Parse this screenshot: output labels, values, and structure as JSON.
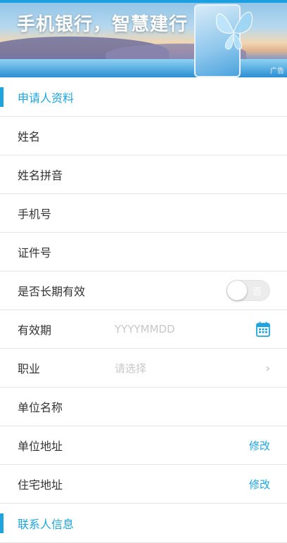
{
  "banner": {
    "slogan": "手机银行，智慧建行",
    "ad_label": "广告"
  },
  "applicant_section": {
    "title": "申请人资料"
  },
  "fields": {
    "name": {
      "label": "姓名"
    },
    "name_pinyin": {
      "label": "姓名拼音"
    },
    "phone": {
      "label": "手机号"
    },
    "id_number": {
      "label": "证件号"
    },
    "long_term": {
      "label": "是否长期有效",
      "toggle_text": "否",
      "on": false
    },
    "validity": {
      "label": "有效期",
      "placeholder": "YYYYMMDD"
    },
    "occupation": {
      "label": "职业",
      "placeholder": "请选择"
    },
    "company_name": {
      "label": "单位名称"
    },
    "company_address": {
      "label": "单位地址",
      "action": "修改"
    },
    "home_address": {
      "label": "住宅地址",
      "action": "修改"
    }
  },
  "contact_section": {
    "title": "联系人信息"
  },
  "colors": {
    "accent": "#1ea5dd",
    "divider": "#e6e6e6",
    "placeholder": "#c8c8c8"
  }
}
